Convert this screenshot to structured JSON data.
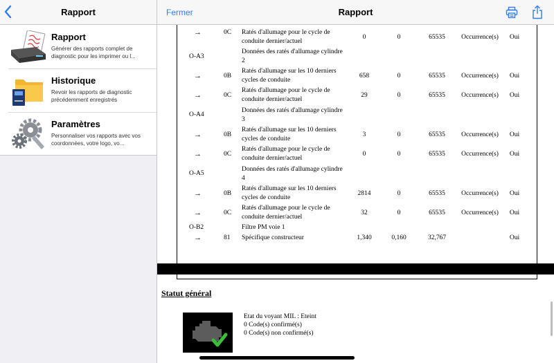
{
  "left": {
    "title": "Rapport",
    "menu": [
      {
        "title": "Rapport",
        "desc": "Générer des rapports complet de diagnostic pour les imprimer ou l...",
        "icon": "printer-report-icon"
      },
      {
        "title": "Historique",
        "desc": "Revoir les rapports de diagnostic précédemment enregistrés",
        "icon": "folder-history-icon"
      },
      {
        "title": "Paramètres",
        "desc": "Personnaliser vos rapports avec vos coordonnées, votre logo, vo...",
        "icon": "gears-settings-icon"
      }
    ]
  },
  "right": {
    "close_label": "Fermer",
    "title": "Rapport"
  },
  "report": {
    "arrow": "→",
    "rows": [
      {
        "id": "",
        "code": "0C",
        "desc": "Ratés d'allumage pour le cycle de conduite dernier/actuel",
        "v1": "0",
        "v2": "0",
        "v3": "65535",
        "unit": "Occurrence(s)",
        "flag": "Oui",
        "arrow": true
      },
      {
        "id": "O-A3",
        "code": "",
        "desc": "Données des ratés d'allumage cylindre 2",
        "v1": "",
        "v2": "",
        "v3": "",
        "unit": "",
        "flag": "",
        "arrow": false
      },
      {
        "id": "",
        "code": "0B",
        "desc": "Ratés d'allumage sur les 10 derniers cycles de conduite",
        "v1": "658",
        "v2": "0",
        "v3": "65535",
        "unit": "Occurrence(s)",
        "flag": "Oui",
        "arrow": true
      },
      {
        "id": "",
        "code": "0C",
        "desc": "Ratés d'allumage pour le cycle de conduite dernier/actuel",
        "v1": "29",
        "v2": "0",
        "v3": "65535",
        "unit": "Occurrence(s)",
        "flag": "Oui",
        "arrow": true
      },
      {
        "id": "O-A4",
        "code": "",
        "desc": "Données des ratés d'allumage cylindre 3",
        "v1": "",
        "v2": "",
        "v3": "",
        "unit": "",
        "flag": "",
        "arrow": false
      },
      {
        "id": "",
        "code": "0B",
        "desc": "Ratés d'allumage sur les 10 derniers cycles de conduite",
        "v1": "3",
        "v2": "0",
        "v3": "65535",
        "unit": "Occurrence(s)",
        "flag": "Oui",
        "arrow": true
      },
      {
        "id": "",
        "code": "0C",
        "desc": "Ratés d'allumage pour le cycle de conduite dernier/actuel",
        "v1": "0",
        "v2": "0",
        "v3": "65535",
        "unit": "Occurrence(s)",
        "flag": "Oui",
        "arrow": true
      },
      {
        "id": "O-A5",
        "code": "",
        "desc": "Données des ratés d'allumage cylindre 4",
        "v1": "",
        "v2": "",
        "v3": "",
        "unit": "",
        "flag": "",
        "arrow": false
      },
      {
        "id": "",
        "code": "0B",
        "desc": "Ratés d'allumage sur les 10 derniers cycles de conduite",
        "v1": "2814",
        "v2": "0",
        "v3": "65535",
        "unit": "Occurrence(s)",
        "flag": "Oui",
        "arrow": true
      },
      {
        "id": "",
        "code": "0C",
        "desc": "Ratés d'allumage pour le cycle de conduite dernier/actuel",
        "v1": "32",
        "v2": "0",
        "v3": "65535",
        "unit": "Occurrence(s)",
        "flag": "Oui",
        "arrow": true
      },
      {
        "id": "O-B2",
        "code": "",
        "desc": "Filtre PM voie 1",
        "v1": "",
        "v2": "",
        "v3": "",
        "unit": "",
        "flag": "",
        "arrow": false
      },
      {
        "id": "",
        "code": "81",
        "desc": "Spécifique constructeur",
        "v1": "1,340",
        "v2": "0,160",
        "v3": "32,767",
        "unit": "",
        "flag": "Oui",
        "arrow": true
      }
    ]
  },
  "status": {
    "title": "Statut général",
    "lines": [
      "Etat du voyant MIL : Eteint",
      "0 Code(s) confirmé(s)",
      "0 Code(s) non confirmé(s)"
    ]
  },
  "colors": {
    "accent": "#2f7cf6",
    "check": "#3bbf3b"
  }
}
